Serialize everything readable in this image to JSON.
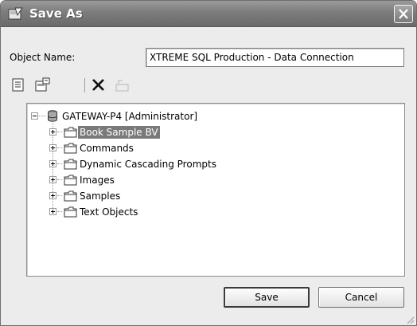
{
  "window": {
    "title": "Save As",
    "title_icon": "save-as-icon",
    "close_icon": "close-icon"
  },
  "form": {
    "object_name_label": "Object Name:",
    "object_name_value": "XTREME SQL Production - Data Connection"
  },
  "toolbar": {
    "buttons": [
      {
        "name": "properties-icon"
      },
      {
        "name": "new-folder-icon"
      },
      {
        "name": "delete-icon"
      },
      {
        "name": "up-folder-icon",
        "enabled": false
      }
    ]
  },
  "tree": {
    "root": {
      "label": "GATEWAY-P4 [Administrator]",
      "icon": "database-icon",
      "expanded": true
    },
    "children": [
      {
        "label": "Book Sample BV",
        "selected": true
      },
      {
        "label": "Commands",
        "selected": false
      },
      {
        "label": "Dynamic Cascading Prompts",
        "selected": false
      },
      {
        "label": "Images",
        "selected": false
      },
      {
        "label": "Samples",
        "selected": false
      },
      {
        "label": "Text Objects",
        "selected": false
      }
    ]
  },
  "buttons": {
    "save_label": "Save",
    "cancel_label": "Cancel"
  },
  "colors": {
    "titlebar": "#7c7c7c",
    "selection": "#7a7a7a",
    "dialog_bg": "#ececec"
  }
}
